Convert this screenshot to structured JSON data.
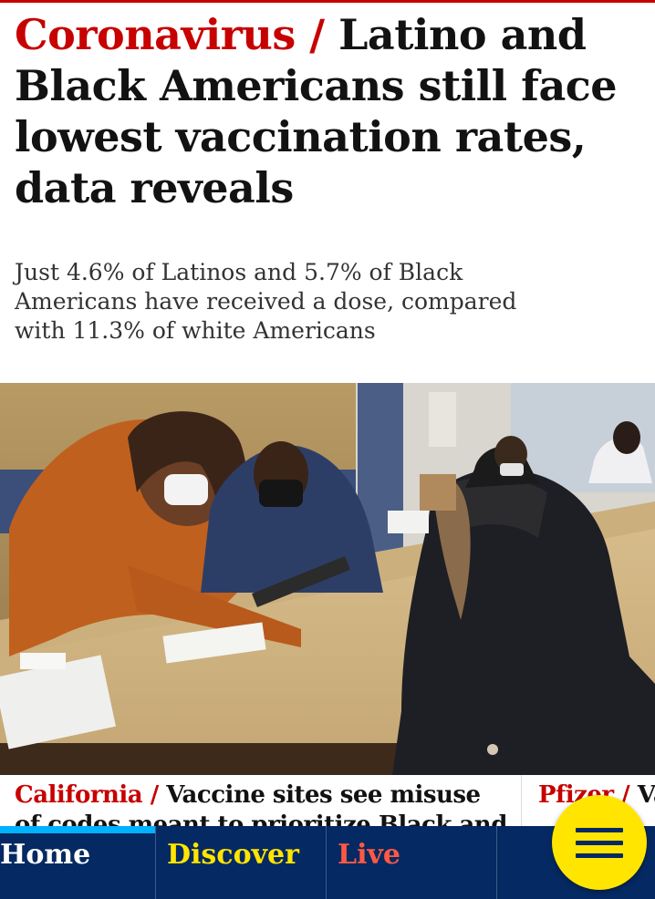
{
  "article": {
    "kicker": "Coronavirus /",
    "title": "Latino and Black Americans still face lowest vaccination rates, data reveals",
    "standfirst": "Just 4.6% of Latinos and 5.7% of Black Americans have received a dose, compared with 11.3% of white Americans"
  },
  "related": [
    {
      "kicker": "California /",
      "title": "Vaccine sites see misuse of codes meant to prioritize Black and"
    },
    {
      "kicker": "Pfizer /",
      "title": "Va"
    }
  ],
  "nav": {
    "items": [
      {
        "label": "Home",
        "active": true
      },
      {
        "label": "Discover",
        "active": false
      },
      {
        "label": "Live",
        "active": false
      }
    ],
    "menu_icon": "hamburger-menu-icon"
  },
  "colors": {
    "kicker_red": "#c70000",
    "nav_bg": "#052962",
    "discover_yellow": "#ffe500",
    "live_red": "#ff5943",
    "active_blue": "#00b2ff"
  }
}
